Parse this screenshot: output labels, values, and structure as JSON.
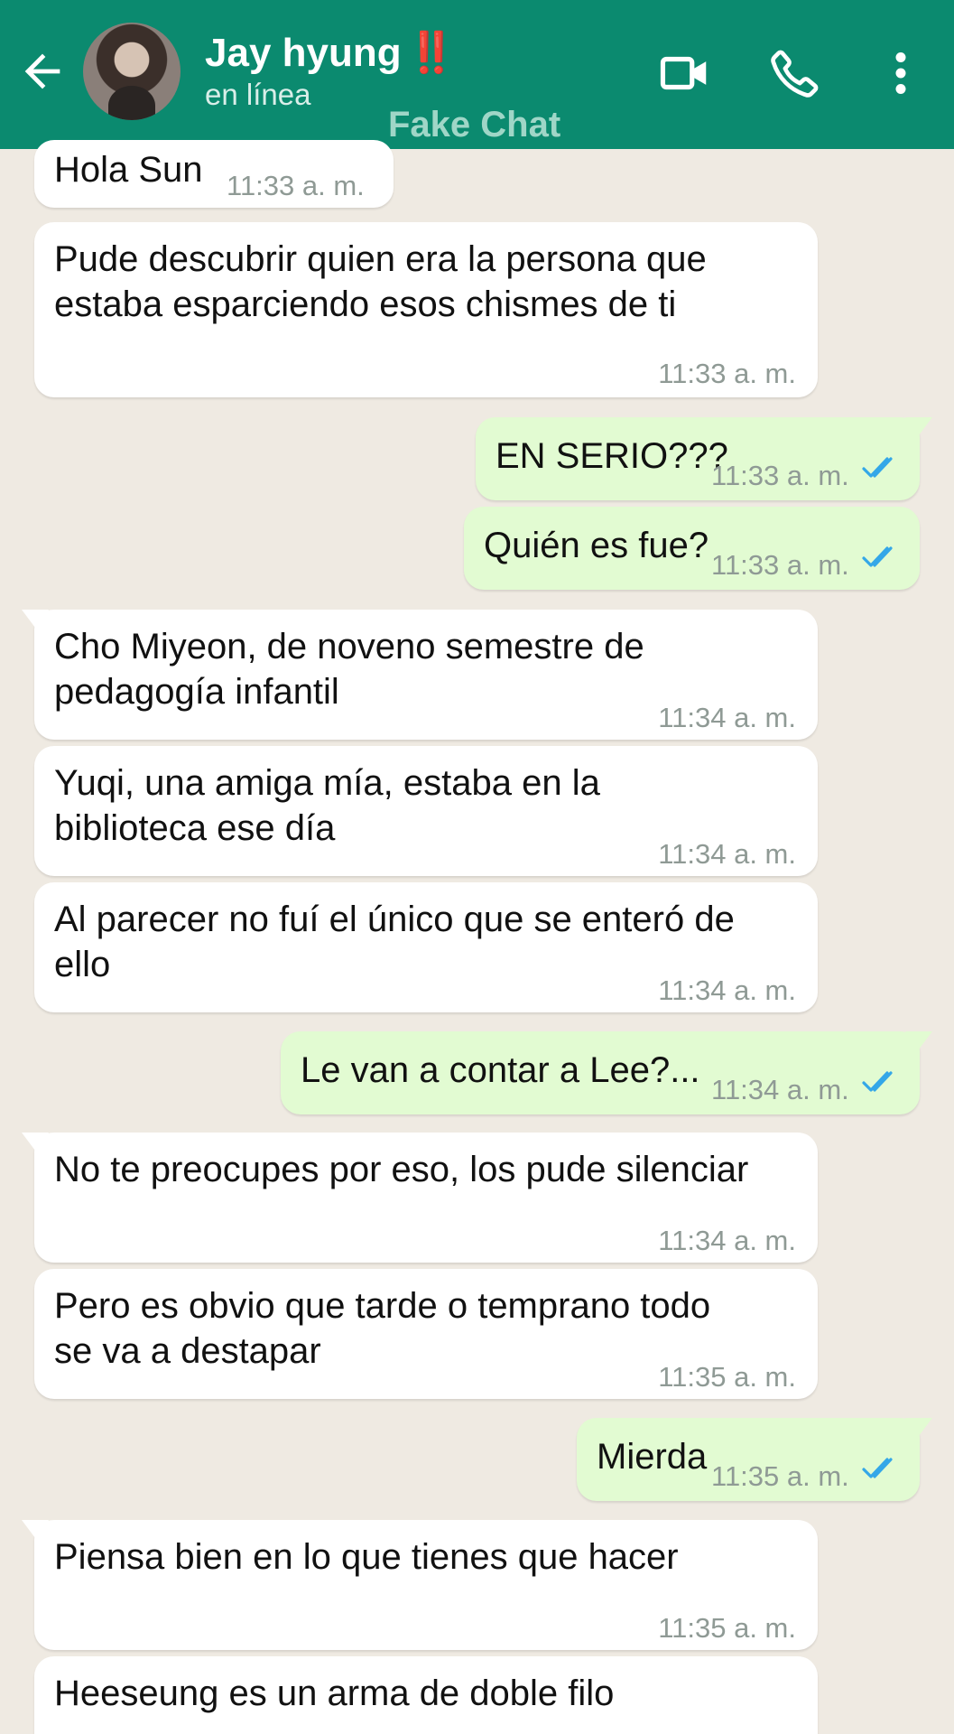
{
  "header": {
    "contact_name": "Jay hyung",
    "contact_alert": "‼️",
    "status": "en línea",
    "watermark": "Fake Chat",
    "icons": [
      "back-arrow-icon",
      "video-call-icon",
      "phone-icon",
      "more-vertical-icon"
    ]
  },
  "colors": {
    "header": "#0b8a6f",
    "incoming": "#ffffff",
    "outgoing": "#e2fbd2",
    "read_ticks": "#34a7e8",
    "alert": "#e0282e"
  },
  "messages": [
    {
      "dir": "in",
      "text": "Hola Sun",
      "time": "11:33 a. m."
    },
    {
      "dir": "in",
      "text": "Pude descubrir quien era la persona que\nestaba esparciendo esos chismes de ti",
      "time": "11:33 a. m."
    },
    {
      "dir": "out",
      "text": "EN SERIO???",
      "time": "11:33 a. m.",
      "status": "read"
    },
    {
      "dir": "out",
      "text": "Quién es fue?",
      "time": "11:33 a. m.",
      "status": "read"
    },
    {
      "dir": "in",
      "text": "Cho Miyeon, de noveno semestre de\npedagogía infantil",
      "time": "11:34 a. m."
    },
    {
      "dir": "in",
      "text": "Yuqi, una amiga mía, estaba en la\nbiblioteca ese día",
      "time": "11:34 a. m."
    },
    {
      "dir": "in",
      "text": "Al parecer no fuí el único que se enteró de\nello",
      "time": "11:34 a. m."
    },
    {
      "dir": "out",
      "text": "Le van a contar a Lee?...",
      "time": "11:34 a. m.",
      "status": "read"
    },
    {
      "dir": "in",
      "text": "No te preocupes por eso, los pude silenciar",
      "time": "11:34 a. m."
    },
    {
      "dir": "in",
      "text": "Pero es obvio que tarde o temprano todo\nse va a destapar",
      "time": "11:35 a. m."
    },
    {
      "dir": "out",
      "text": "Mierda",
      "time": "11:35 a. m.",
      "status": "read"
    },
    {
      "dir": "in",
      "text": "Piensa bien en lo que tienes que hacer",
      "time": "11:35 a. m."
    },
    {
      "dir": "in",
      "text": "Heeseung es un arma de doble filo",
      "time": ""
    }
  ]
}
